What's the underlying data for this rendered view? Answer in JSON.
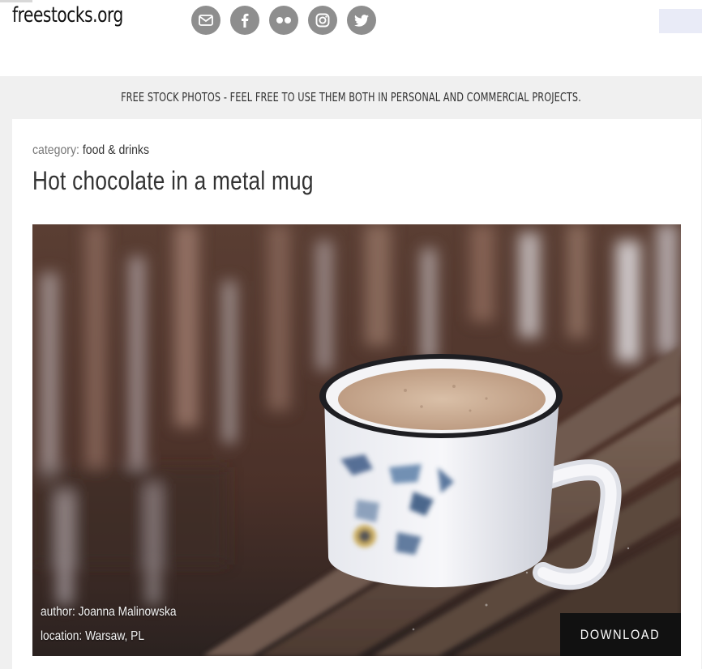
{
  "header": {
    "logo": "freestocks.org",
    "social_icons": [
      "email-icon",
      "facebook-icon",
      "flickr-icon",
      "instagram-icon",
      "twitter-icon"
    ]
  },
  "tagline": "FREE STOCK PHOTOS - FEEL FREE TO USE THEM BOTH IN PERSONAL AND COMMERCIAL PROJECTS.",
  "post": {
    "category_label": "category:",
    "category": "food & drinks",
    "title": "Hot chocolate in a metal mug",
    "author": "author: Joanna Malinowska",
    "location": "location: Warsaw, PL",
    "download_label": "DOWNLOAD"
  },
  "colors": {
    "icon_bg": "#8e8e8e",
    "download_bg": "#111111",
    "page_bg": "#f0f0f0"
  }
}
